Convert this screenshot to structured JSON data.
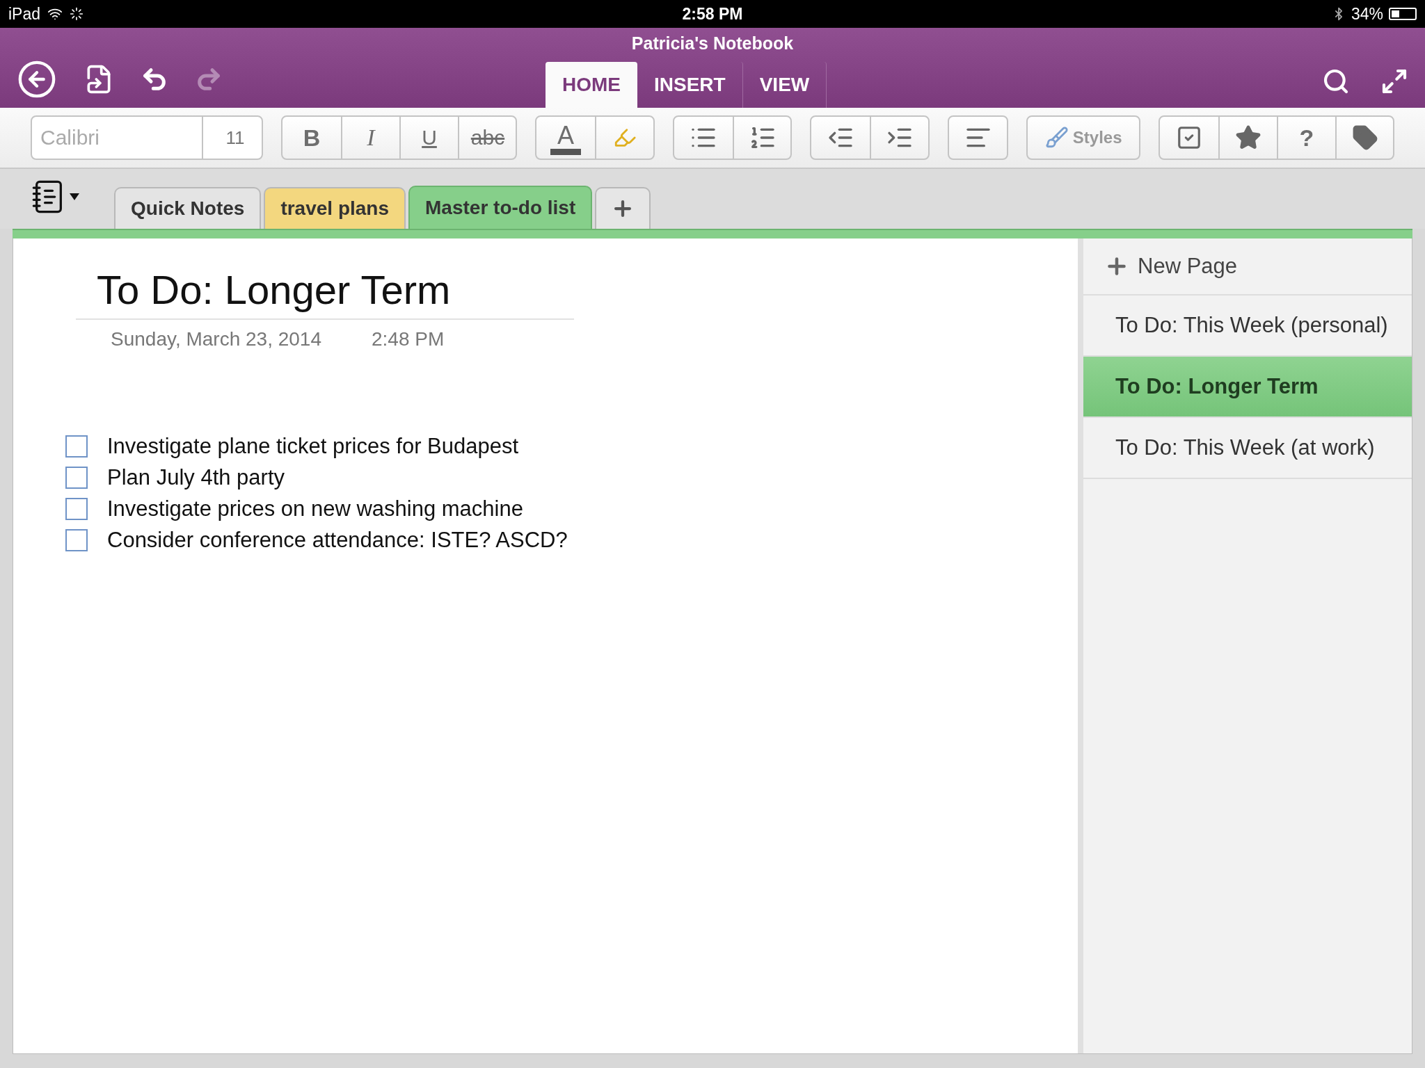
{
  "status_bar": {
    "device": "iPad",
    "time": "2:58 PM",
    "battery": "34%"
  },
  "window": {
    "title": "Patricia's Notebook"
  },
  "ribbon_tabs": [
    {
      "label": "HOME",
      "selected": true
    },
    {
      "label": "INSERT",
      "selected": false
    },
    {
      "label": "VIEW",
      "selected": false
    }
  ],
  "toolbar": {
    "font": "Calibri",
    "font_size": "11",
    "bold": "B",
    "italic": "I",
    "underline": "U",
    "strikethrough": "abc",
    "font_color": "A",
    "styles": "Styles",
    "help": "?"
  },
  "sections": [
    {
      "label": "Quick Notes",
      "color": "#e4e4e4",
      "selected": false
    },
    {
      "label": "travel plans",
      "color": "#f3d77f",
      "selected": false
    },
    {
      "label": "Master to-do list",
      "color": "#86cf8a",
      "selected": true
    }
  ],
  "note": {
    "title": "To Do: Longer Term",
    "date": "Sunday, March 23, 2014",
    "time": "2:48 PM",
    "todos": [
      {
        "text": "Investigate plane ticket prices for Budapest",
        "checked": false
      },
      {
        "text": "Plan July 4th party",
        "checked": false
      },
      {
        "text": "Investigate prices on new washing machine",
        "checked": false
      },
      {
        "text": "Consider conference attendance: ISTE? ASCD?",
        "checked": false
      }
    ]
  },
  "pages": {
    "new_page": "New Page",
    "items": [
      {
        "label": "To Do: This Week (personal)",
        "selected": false
      },
      {
        "label": "To Do: Longer Term",
        "selected": true
      },
      {
        "label": "To Do: This Week (at work)",
        "selected": false
      }
    ]
  }
}
